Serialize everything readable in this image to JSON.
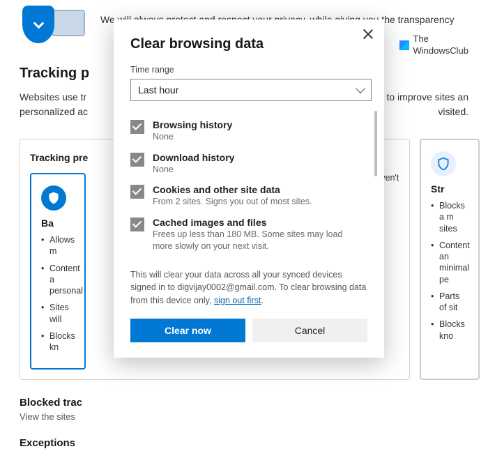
{
  "bg": {
    "privacy_subtitle": "We will always protect and respect your privacy, while giving you the transparency",
    "tracking_heading": "Tracking p",
    "tracking_desc_1": "Websites use tr",
    "tracking_desc_1_end": "s info to improve sites an",
    "tracking_desc_2": "personalized ac",
    "tracking_desc_2_end": "visited.",
    "panel_header": "Tracking pre",
    "watermark_line1": "The",
    "watermark_line2": "WindowsClub",
    "card_basic": {
      "title": "Ba",
      "items": [
        "Allows m",
        "Content a\npersonal",
        "Sites will",
        "Blocks kn"
      ]
    },
    "card_strict": {
      "title": "Str",
      "items": [
        "Blocks a m\nsites",
        "Content an\nminimal pe",
        "Parts of sit",
        "Blocks kno"
      ],
      "note_end": "ven't"
    },
    "blocked_heading": "Blocked trac",
    "blocked_sub": "View the sites",
    "exceptions_heading": "Exceptions"
  },
  "modal": {
    "title": "Clear browsing data",
    "time_label": "Time range",
    "time_value": "Last hour",
    "options": [
      {
        "title": "Browsing history",
        "sub": "None"
      },
      {
        "title": "Download history",
        "sub": "None"
      },
      {
        "title": "Cookies and other site data",
        "sub": "From 2 sites. Signs you out of most sites."
      },
      {
        "title": "Cached images and files",
        "sub": "Frees up less than 180 MB. Some sites may load more slowly on your next visit."
      }
    ],
    "sync_note_1": "This will clear your data across all your synced devices signed in to digvijay0002@gmail.com. To clear browsing data from this device only, ",
    "sync_link": "sign out first",
    "sync_note_2": ".",
    "clear_btn": "Clear now",
    "cancel_btn": "Cancel"
  }
}
